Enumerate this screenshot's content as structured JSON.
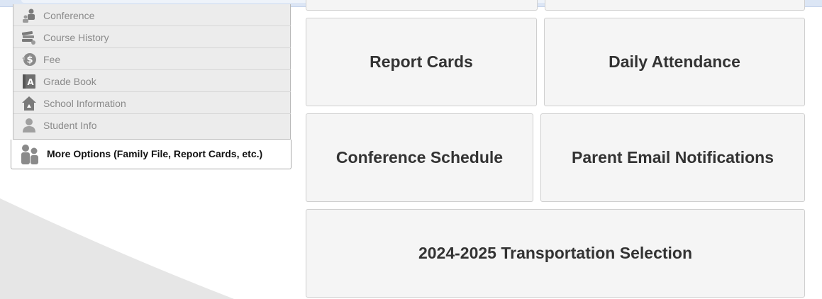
{
  "sidebar": {
    "items": [
      {
        "label": "Conference",
        "icon": "conference-icon"
      },
      {
        "label": "Course History",
        "icon": "books-icon"
      },
      {
        "label": "Fee",
        "icon": "fee-dollar-icon"
      },
      {
        "label": "Grade Book",
        "icon": "gradebook-icon"
      },
      {
        "label": "School Information",
        "icon": "school-house-icon"
      },
      {
        "label": "Student Info",
        "icon": "student-icon"
      }
    ],
    "more_options": {
      "label": "More Options (Family File, Report Cards, etc.)",
      "icon": "family-icon"
    }
  },
  "tiles": {
    "report_cards": "Report Cards",
    "daily_attendance": "Daily Attendance",
    "conference_schedule": "Conference Schedule",
    "parent_email_notifications": "Parent Email Notifications",
    "transportation_selection": "2024-2025 Transportation Selection"
  },
  "colors": {
    "tile_bg": "#f5f5f5",
    "tile_text": "#333333",
    "sidebar_bg": "#ececec",
    "sidebar_text": "#8a8a8a"
  }
}
